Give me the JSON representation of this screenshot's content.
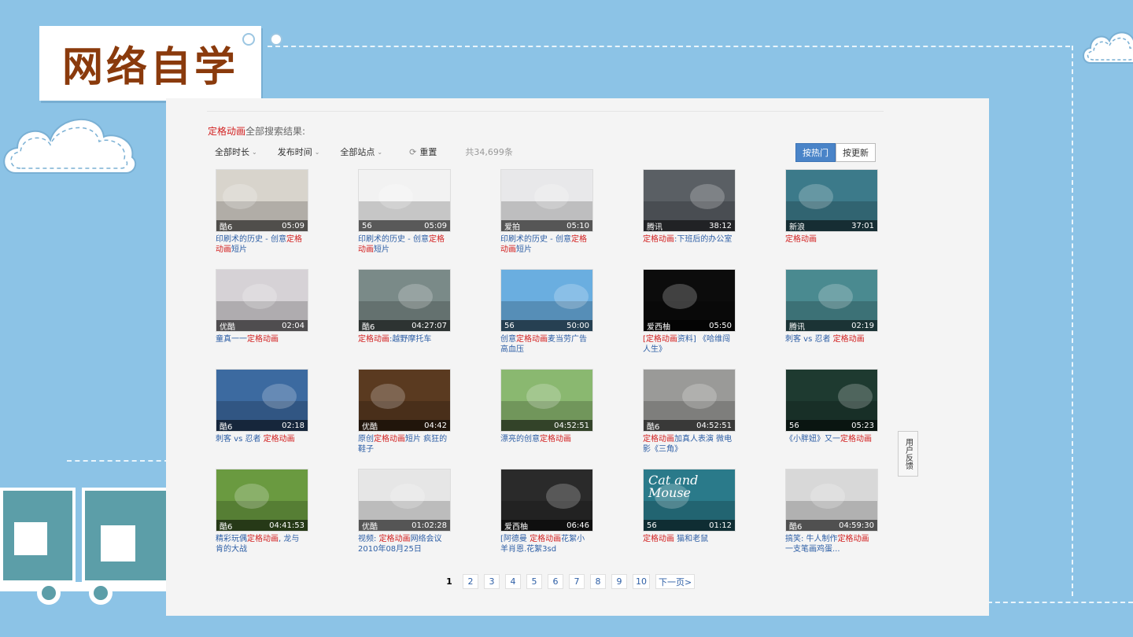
{
  "slide_title": "网络自学",
  "search": {
    "keyword": "定格动画",
    "suffix": "全部搜索结果:",
    "filters": [
      "全部时长",
      "发布时间",
      "全部站点"
    ],
    "reset_label": "重置",
    "count_label": "共34,699条",
    "sort": [
      {
        "label": "按热门",
        "active": true
      },
      {
        "label": "按更新",
        "active": false
      }
    ]
  },
  "videos": [
    {
      "title_parts": [
        {
          "t": "印刷术的历史 - 创意"
        },
        {
          "t": "定格动画",
          "kw": true
        },
        {
          "t": "短片"
        }
      ],
      "source": "酷6",
      "duration": "05:09",
      "thumb_color": "#d8d4cc"
    },
    {
      "title_parts": [
        {
          "t": "印刷术的历史 - 创意"
        },
        {
          "t": "定格动画",
          "kw": true
        },
        {
          "t": "短片"
        }
      ],
      "source": "56",
      "duration": "05:09",
      "thumb_color": "#f2f2f2"
    },
    {
      "title_parts": [
        {
          "t": "印刷术的历史 - 创意"
        },
        {
          "t": "定格动画",
          "kw": true
        },
        {
          "t": "短片"
        }
      ],
      "source": "爱拍",
      "duration": "05:10",
      "thumb_color": "#e8e8ea"
    },
    {
      "title_parts": [
        {
          "t": "定格动画",
          "kw": true
        },
        {
          "t": ":下班后的办公室"
        }
      ],
      "source": "腾讯",
      "duration": "38:12",
      "thumb_color": "#5a5f64"
    },
    {
      "title_parts": [
        {
          "t": "定格动画",
          "kw": true
        }
      ],
      "source": "新浪",
      "duration": "37:01",
      "thumb_color": "#3c7a8a"
    },
    {
      "title_parts": [
        {
          "t": "童真一一"
        },
        {
          "t": "定格动画",
          "kw": true
        }
      ],
      "source": "优酷",
      "duration": "02:04",
      "thumb_color": "#d6d2d6"
    },
    {
      "title_parts": [
        {
          "t": "定格动画",
          "kw": true
        },
        {
          "t": ":越野摩托车"
        }
      ],
      "source": "酷6",
      "duration": "04:27:07",
      "thumb_color": "#7a8a88"
    },
    {
      "title_parts": [
        {
          "t": "创意"
        },
        {
          "t": "定格动画",
          "kw": true
        },
        {
          "t": "麦当劳广告高血压"
        }
      ],
      "source": "56",
      "duration": "50:00",
      "thumb_color": "#6aaee0"
    },
    {
      "title_parts": [
        {
          "t": "[定格动画",
          "kw": true
        },
        {
          "t": "资料] 《哈维闯人生》"
        }
      ],
      "source": "爱西柚",
      "duration": "05:50",
      "thumb_color": "#0c0c0c"
    },
    {
      "title_parts": [
        {
          "t": "刺客 vs 忍者 "
        },
        {
          "t": "定格动画",
          "kw": true
        }
      ],
      "source": "腾讯",
      "duration": "02:19",
      "thumb_color": "#4a8a90"
    },
    {
      "title_parts": [
        {
          "t": "刺客 vs 忍者 "
        },
        {
          "t": "定格动画",
          "kw": true
        }
      ],
      "source": "酷6",
      "duration": "02:18",
      "thumb_color": "#3c6aa0"
    },
    {
      "title_parts": [
        {
          "t": "原创"
        },
        {
          "t": "定格动画",
          "kw": true
        },
        {
          "t": "短片 疯狂的鞋子"
        }
      ],
      "source": "优酷",
      "duration": "04:42",
      "thumb_color": "#5a3a20"
    },
    {
      "title_parts": [
        {
          "t": "漂亮的创意"
        },
        {
          "t": "定格动画",
          "kw": true
        }
      ],
      "source": "",
      "duration": "04:52:51",
      "thumb_color": "#8ab870"
    },
    {
      "title_parts": [
        {
          "t": "定格动画",
          "kw": true
        },
        {
          "t": "加真人表演 微电影《三角》"
        }
      ],
      "source": "酷6",
      "duration": "04:52:51",
      "thumb_color": "#9a9a98"
    },
    {
      "title_parts": [
        {
          "t": "《小胖妞》又一"
        },
        {
          "t": "定格动画",
          "kw": true
        }
      ],
      "source": "56",
      "duration": "05:23",
      "thumb_color": "#1e3a30"
    },
    {
      "title_parts": [
        {
          "t": "精彩玩偶"
        },
        {
          "t": "定格动画",
          "kw": true
        },
        {
          "t": ", 龙与肯的大战"
        }
      ],
      "source": "酷6",
      "duration": "04:41:53",
      "thumb_color": "#6a9a40"
    },
    {
      "title_parts": [
        {
          "t": "视频: "
        },
        {
          "t": "定格动画",
          "kw": true
        },
        {
          "t": "网络会议2010年08月25日"
        }
      ],
      "source": "优酷",
      "duration": "01:02:28",
      "thumb_color": "#e6e6e6"
    },
    {
      "title_parts": [
        {
          "t": "[阿德曼 "
        },
        {
          "t": "定格动画",
          "kw": true
        },
        {
          "t": "花絮小羊肖恩.花絮3sd"
        }
      ],
      "source": "爱西柚",
      "duration": "06:46",
      "thumb_color": "#2a2a2a"
    },
    {
      "title_parts": [
        {
          "t": "定格动画",
          "kw": true
        },
        {
          "t": " 猫和老鼠"
        }
      ],
      "source": "56",
      "duration": "01:12",
      "thumb_color": "#2a7a8a",
      "overlay_text": [
        "Cat",
        "and",
        "Mouse"
      ]
    },
    {
      "title_parts": [
        {
          "t": "搞笑: 牛人制作"
        },
        {
          "t": "定格动画",
          "kw": true
        },
        {
          "t": " 一支笔画鸡蛋..."
        }
      ],
      "source": "酷6",
      "duration": "04:59:30",
      "thumb_color": "#d8d8d8"
    }
  ],
  "pagination": {
    "pages": [
      "1",
      "2",
      "3",
      "4",
      "5",
      "6",
      "7",
      "8",
      "9",
      "10"
    ],
    "current": "1",
    "next_label": "下一页>"
  },
  "feedback_label": "用户反馈"
}
